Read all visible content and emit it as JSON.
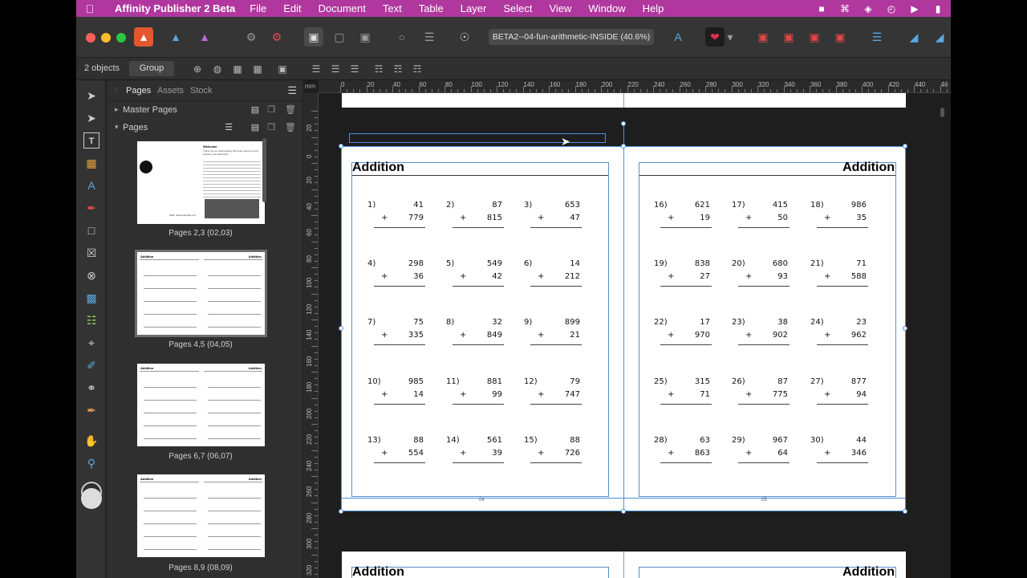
{
  "menubar": {
    "app_name": "Affinity Publisher 2 Beta",
    "items": [
      "File",
      "Edit",
      "Document",
      "Text",
      "Table",
      "Layer",
      "Select",
      "View",
      "Window",
      "Help"
    ]
  },
  "toolbar": {
    "document_title": "BETA2--04-fun-arithmetic-INSIDE (40.6%)"
  },
  "context": {
    "object_count": "2 objects",
    "group_label": "Group"
  },
  "panel": {
    "tabs": [
      "Pages",
      "Assets",
      "Stock"
    ],
    "master_pages_label": "Master Pages",
    "pages_label": "Pages",
    "thumbs": [
      {
        "label": "Pages 2,3 (02,03)"
      },
      {
        "label": "Pages 4,5 (04,05)"
      },
      {
        "label": "Pages 6,7 (06,07)"
      },
      {
        "label": "Pages 8,9 (08,09)"
      }
    ],
    "thumb_heading": "Addition",
    "intro_heading": "Welcome",
    "intro_text": "Thank you for downloading this book. Have fun and practise your arithmetic!",
    "thumb_footer": "Math: www.example.com"
  },
  "ruler": {
    "unit": "mm",
    "h_labels": [
      "0",
      "20",
      "40",
      "60",
      "80",
      "100",
      "120",
      "140",
      "160",
      "180",
      "200",
      "220",
      "240",
      "260",
      "280",
      "300",
      "320",
      "340",
      "360",
      "380",
      "400",
      "420",
      "440",
      "46"
    ],
    "v_labels": [
      "20",
      "0",
      "20",
      "40",
      "60",
      "80",
      "100",
      "120",
      "140",
      "160",
      "180",
      "200",
      "220",
      "240",
      "260",
      "280",
      "300",
      "320"
    ]
  },
  "spread": {
    "left_title": "Addition",
    "right_title": "Addition",
    "left_folio": "04",
    "right_folio": "05",
    "left_problems": [
      {
        "n": "1)",
        "a": "41",
        "b": "779"
      },
      {
        "n": "2)",
        "a": "87",
        "b": "815"
      },
      {
        "n": "3)",
        "a": "653",
        "b": "47"
      },
      {
        "n": "4)",
        "a": "298",
        "b": "36"
      },
      {
        "n": "5)",
        "a": "549",
        "b": "42"
      },
      {
        "n": "6)",
        "a": "14",
        "b": "212"
      },
      {
        "n": "7)",
        "a": "75",
        "b": "335"
      },
      {
        "n": "8)",
        "a": "32",
        "b": "849"
      },
      {
        "n": "9)",
        "a": "899",
        "b": "21"
      },
      {
        "n": "10)",
        "a": "985",
        "b": "14"
      },
      {
        "n": "11)",
        "a": "881",
        "b": "99"
      },
      {
        "n": "12)",
        "a": "79",
        "b": "747"
      },
      {
        "n": "13)",
        "a": "88",
        "b": "554"
      },
      {
        "n": "14)",
        "a": "561",
        "b": "39"
      },
      {
        "n": "15)",
        "a": "88",
        "b": "726"
      }
    ],
    "right_problems": [
      {
        "n": "16)",
        "a": "621",
        "b": "19"
      },
      {
        "n": "17)",
        "a": "415",
        "b": "50"
      },
      {
        "n": "18)",
        "a": "986",
        "b": "35"
      },
      {
        "n": "19)",
        "a": "838",
        "b": "27"
      },
      {
        "n": "20)",
        "a": "680",
        "b": "93"
      },
      {
        "n": "21)",
        "a": "71",
        "b": "588"
      },
      {
        "n": "22)",
        "a": "17",
        "b": "970"
      },
      {
        "n": "23)",
        "a": "38",
        "b": "902"
      },
      {
        "n": "24)",
        "a": "23",
        "b": "962"
      },
      {
        "n": "25)",
        "a": "315",
        "b": "71"
      },
      {
        "n": "26)",
        "a": "87",
        "b": "775"
      },
      {
        "n": "27)",
        "a": "877",
        "b": "94"
      },
      {
        "n": "28)",
        "a": "63",
        "b": "863"
      },
      {
        "n": "29)",
        "a": "967",
        "b": "64"
      },
      {
        "n": "30)",
        "a": "44",
        "b": "346"
      }
    ],
    "plus_sign": "+",
    "next_left_title": "Addition",
    "next_right_title": "Addition"
  },
  "colors": {
    "menubar": "#b0379e",
    "selection": "#4a90e2",
    "margin_guide": "#5b8fc8"
  }
}
